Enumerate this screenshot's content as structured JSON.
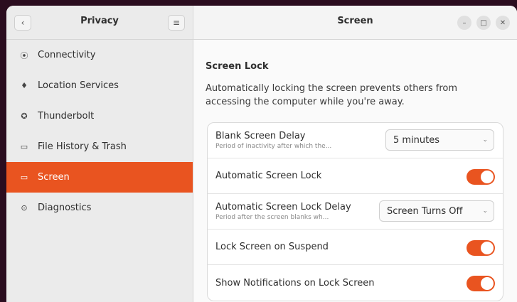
{
  "sidebar": {
    "title": "Privacy",
    "back_icon": "chevron-left-icon",
    "menu_icon": "hamburger-icon",
    "items": [
      {
        "label": "Connectivity",
        "icon": "wifi-icon",
        "glyph": "⦿",
        "active": false
      },
      {
        "label": "Location Services",
        "icon": "location-pin-icon",
        "glyph": "♦",
        "active": false
      },
      {
        "label": "Thunderbolt",
        "icon": "thunderbolt-icon",
        "glyph": "✪",
        "active": false
      },
      {
        "label": "File History & Trash",
        "icon": "folder-icon",
        "glyph": "▭",
        "active": false
      },
      {
        "label": "Screen",
        "icon": "monitor-icon",
        "glyph": "▭",
        "active": true
      },
      {
        "label": "Diagnostics",
        "icon": "diagnostics-icon",
        "glyph": "⊙",
        "active": false
      }
    ]
  },
  "main": {
    "title": "Screen",
    "window_controls": [
      "minimize",
      "maximize",
      "close"
    ],
    "section": {
      "title": "Screen Lock",
      "description": "Automatically locking the screen prevents others from accessing the computer while you're away."
    },
    "rows": [
      {
        "label": "Blank Screen Delay",
        "subtitle": "Period of inactivity after which the...",
        "control": "dropdown",
        "value": "5 minutes"
      },
      {
        "label": "Automatic Screen Lock",
        "control": "toggle",
        "on": true
      },
      {
        "label": "Automatic Screen Lock Delay",
        "subtitle": "Period after the screen blanks wh...",
        "control": "dropdown",
        "value": "Screen Turns Off"
      },
      {
        "label": "Lock Screen on Suspend",
        "control": "toggle",
        "on": true
      },
      {
        "label": "Show Notifications on Lock Screen",
        "control": "toggle",
        "on": true
      }
    ]
  },
  "colors": {
    "accent": "#e95420",
    "sidebar_bg": "#ebebeb",
    "content_bg": "#fafafa",
    "desktop_bg": "#2b0d1f"
  }
}
